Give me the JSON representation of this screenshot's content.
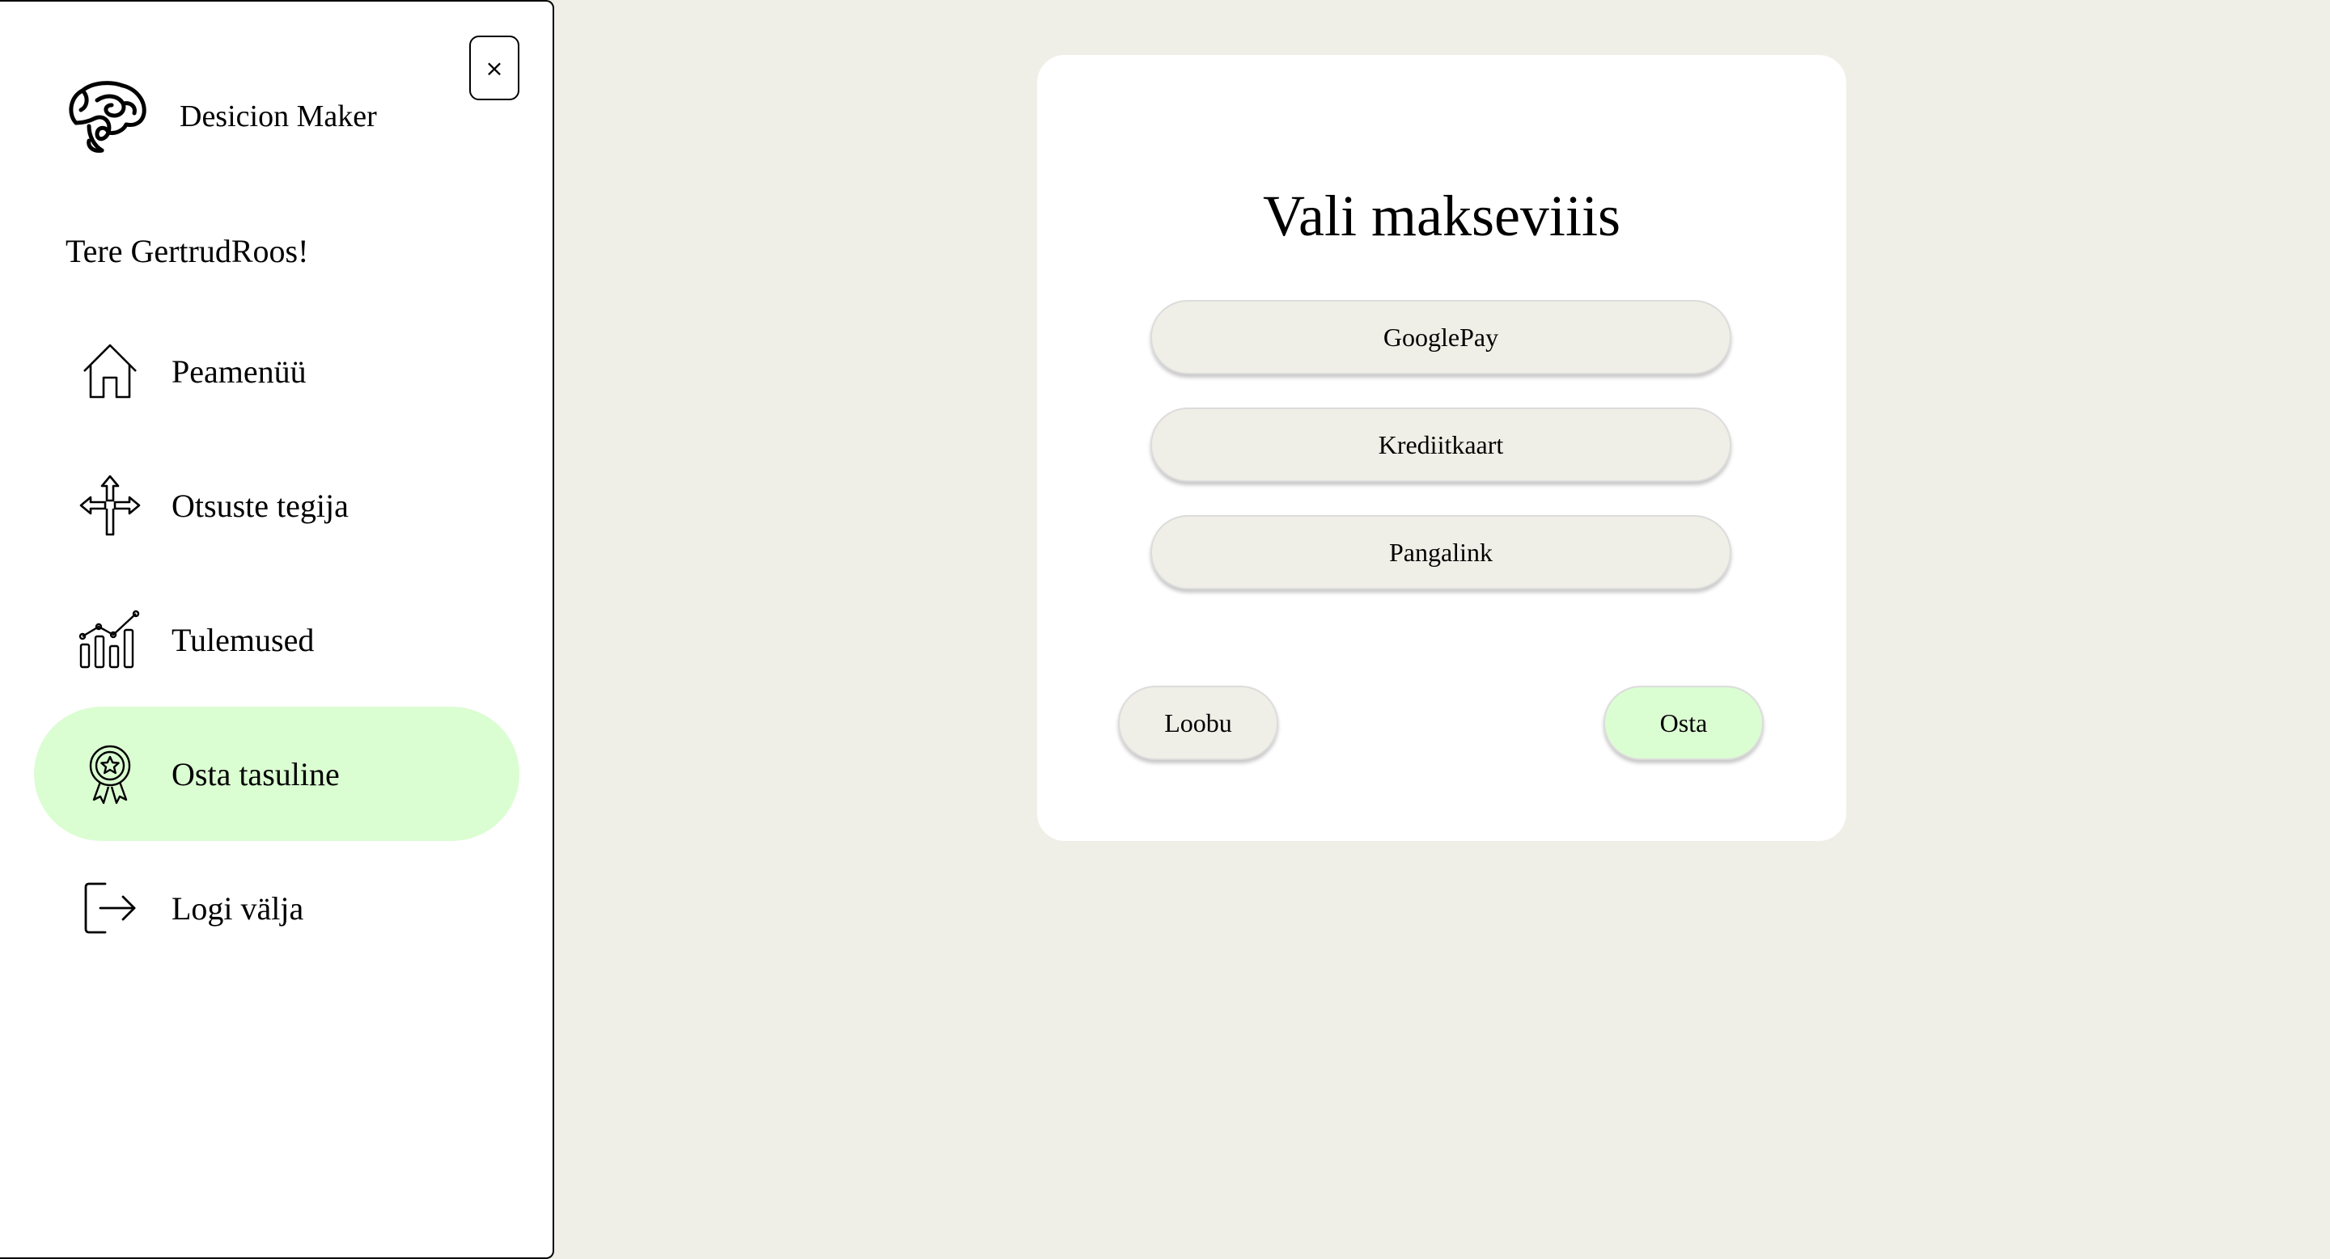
{
  "sidebar": {
    "close_label": "×",
    "brand": {
      "name": "Desicion Maker",
      "logo_icon": "brain-icon"
    },
    "greeting": "Tere GertrudRoos!",
    "active_color": "#dbfdd2",
    "items": [
      {
        "label": "Peamenüü",
        "icon": "home-icon",
        "active": false
      },
      {
        "label": "Otsuste tegija",
        "icon": "direction-arrows-icon",
        "active": false
      },
      {
        "label": "Tulemused",
        "icon": "chart-icon",
        "active": false
      },
      {
        "label": "Osta tasuline",
        "icon": "award-badge-icon",
        "active": true
      },
      {
        "label": "Logi välja",
        "icon": "logout-icon",
        "active": false
      }
    ]
  },
  "payment": {
    "title": "Vali makseviiis",
    "options": [
      "GooglePay",
      "Krediitkaart",
      "Pangalink"
    ],
    "cancel_label": "Loobu",
    "buy_label": "Osta"
  },
  "colors": {
    "background": "#f0efe7",
    "accent": "#dbfdd2"
  }
}
